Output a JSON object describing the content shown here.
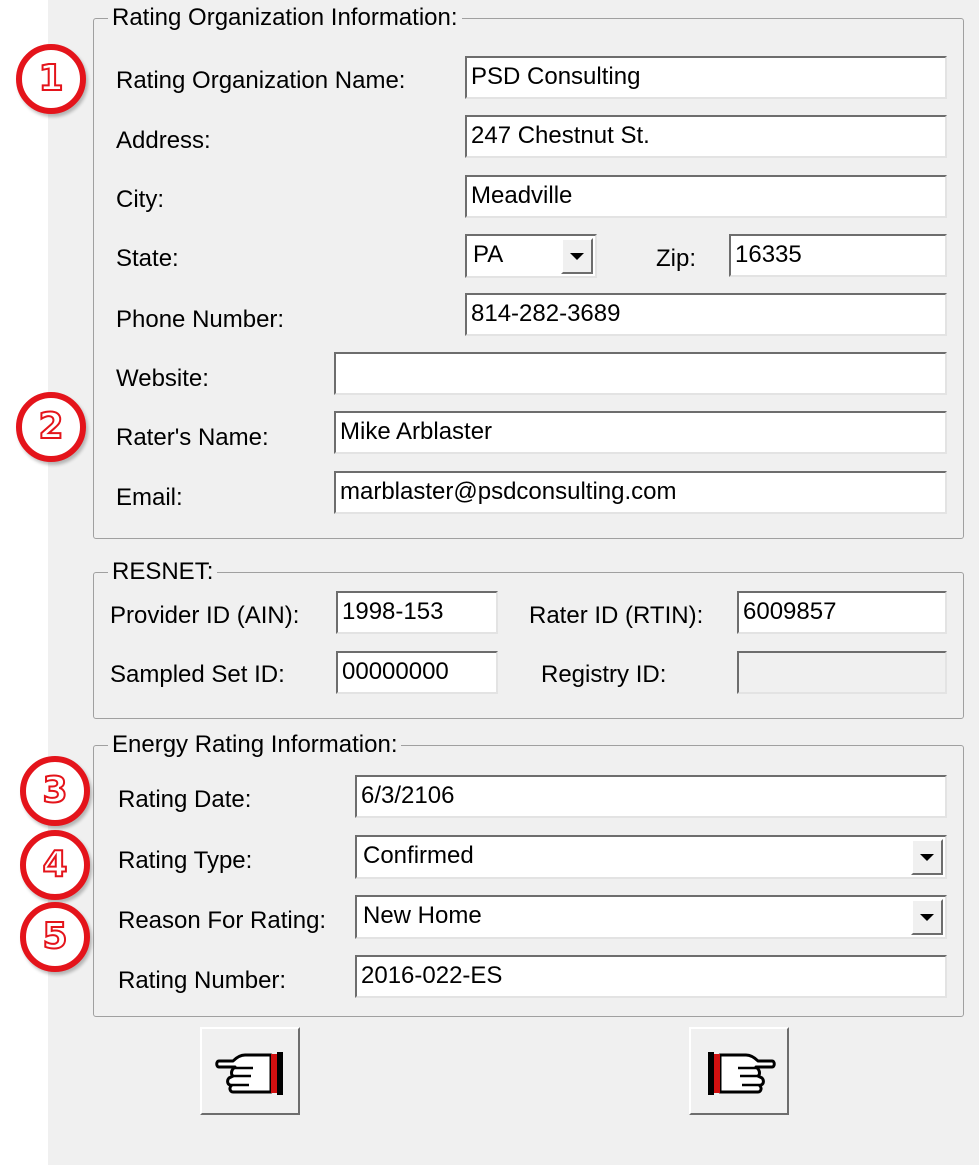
{
  "rating_org": {
    "legend": "Rating Organization Information:",
    "name_label": "Rating Organization Name:",
    "name": "PSD Consulting",
    "address_label": "Address:",
    "address": "247 Chestnut St.",
    "city_label": "City:",
    "city": "Meadville",
    "state_label": "State:",
    "state": "PA",
    "zip_label": "Zip:",
    "zip": "16335",
    "phone_label": "Phone Number:",
    "phone": "814-282-3689",
    "website_label": "Website:",
    "website": "",
    "rater_label": "Rater's Name:",
    "rater": "Mike Arblaster",
    "email_label": "Email:",
    "email": "marblaster@psdconsulting.com"
  },
  "resnet": {
    "legend": "RESNET:",
    "provider_label": "Provider ID (AIN):",
    "provider": "1998-153",
    "rater_id_label": "Rater ID (RTIN):",
    "rater_id": "6009857",
    "sampled_label": "Sampled Set ID:",
    "sampled": "00000000",
    "registry_label": "Registry ID:",
    "registry": ""
  },
  "energy": {
    "legend": "Energy Rating Information:",
    "date_label": "Rating Date:",
    "date": "6/3/2106",
    "type_label": "Rating Type:",
    "type": "Confirmed",
    "reason_label": "Reason For Rating:",
    "reason": "New Home",
    "number_label": "Rating Number:",
    "number": "2016-022-ES"
  },
  "badges": [
    "1",
    "2",
    "3",
    "4",
    "5"
  ],
  "nav": {
    "back_icon": "hand-pointing-left-icon",
    "next_icon": "hand-pointing-right-icon"
  },
  "colors": {
    "badge_red": "#e4141b",
    "panel_bg": "#f0f0f0"
  }
}
